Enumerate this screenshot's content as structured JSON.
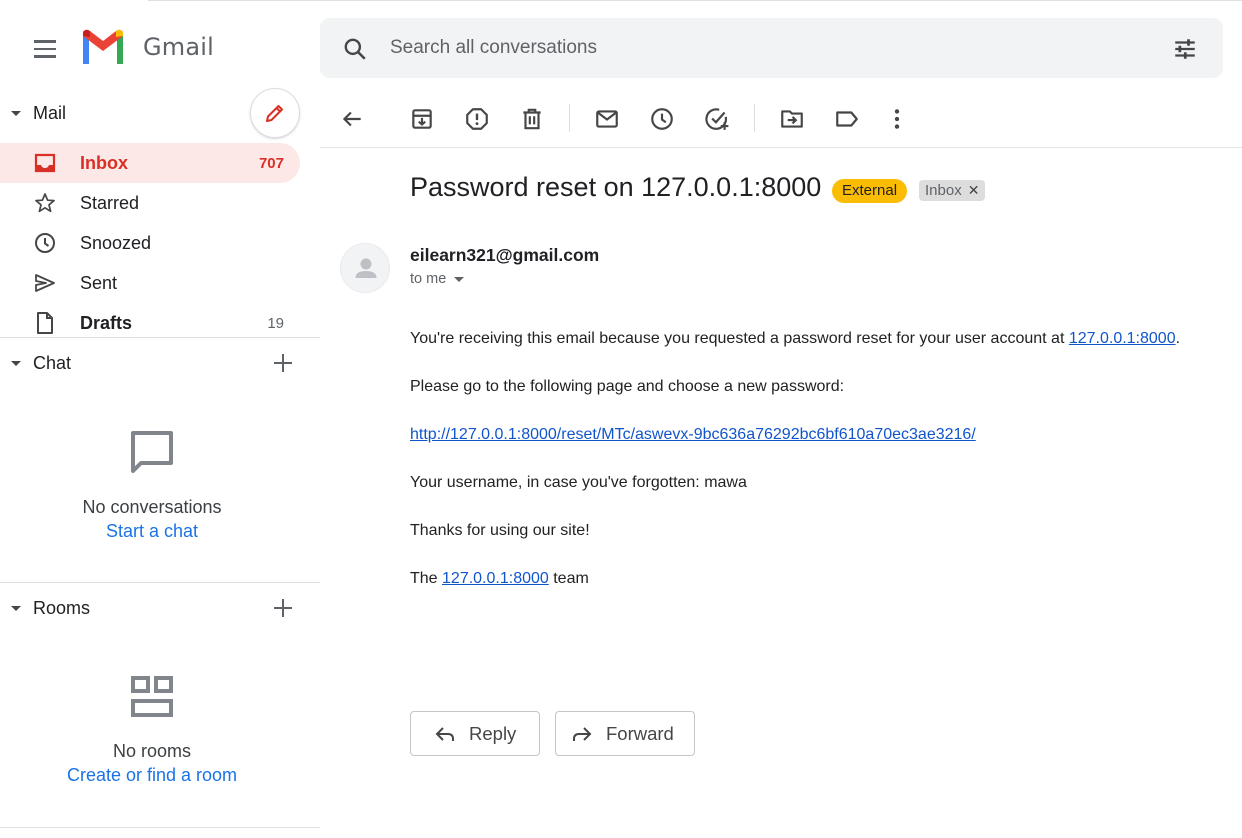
{
  "app": {
    "name": "Gmail"
  },
  "search": {
    "placeholder": "Search all conversations"
  },
  "sidebar": {
    "mail_section": "Mail",
    "items": [
      {
        "label": "Inbox",
        "count": "707",
        "icon": "inbox-icon",
        "active": true
      },
      {
        "label": "Starred",
        "count": "",
        "icon": "star-icon"
      },
      {
        "label": "Snoozed",
        "count": "",
        "icon": "clock-icon"
      },
      {
        "label": "Sent",
        "count": "",
        "icon": "send-icon"
      },
      {
        "label": "Drafts",
        "count": "19",
        "icon": "draft-icon"
      }
    ],
    "chat": {
      "title": "Chat",
      "empty_text": "No conversations",
      "link": "Start a chat"
    },
    "rooms": {
      "title": "Rooms",
      "empty_text": "No rooms",
      "link": "Create or find a room"
    }
  },
  "toolbar": {
    "icons": [
      "back-arrow-icon",
      "archive-icon",
      "report-spam-icon",
      "delete-icon",
      "mark-unread-icon",
      "snooze-icon",
      "add-task-icon",
      "move-to-icon",
      "labels-icon",
      "more-icon"
    ]
  },
  "message": {
    "subject": "Password reset on 127.0.0.1:8000",
    "labels": {
      "external": "External",
      "inbox": "Inbox"
    },
    "sender": "eilearn321@gmail.com",
    "recipient": "to me",
    "body": {
      "line1_text": "You're receiving this email because you requested a password reset for your user account at ",
      "line1_link": "127.0.0.1:8000",
      "line1_end": ".",
      "line2": "Please go to the following page and choose a new password:",
      "reset_link": "http://127.0.0.1:8000/reset/MTc/aswevx-9bc636a76292bc6bf610a70ec3ae3216/",
      "line4": "Your username, in case you've forgotten: mawa",
      "line5": "Thanks for using our site!",
      "line6_start": "The ",
      "line6_link": "127.0.0.1:8000",
      "line6_end": " team"
    }
  },
  "actions": {
    "reply": "Reply",
    "forward": "Forward"
  },
  "colors": {
    "accent_red": "#d93025",
    "link_blue": "#1155cc",
    "external_label": "#fbbc04",
    "active_bg": "#fce8e6"
  }
}
